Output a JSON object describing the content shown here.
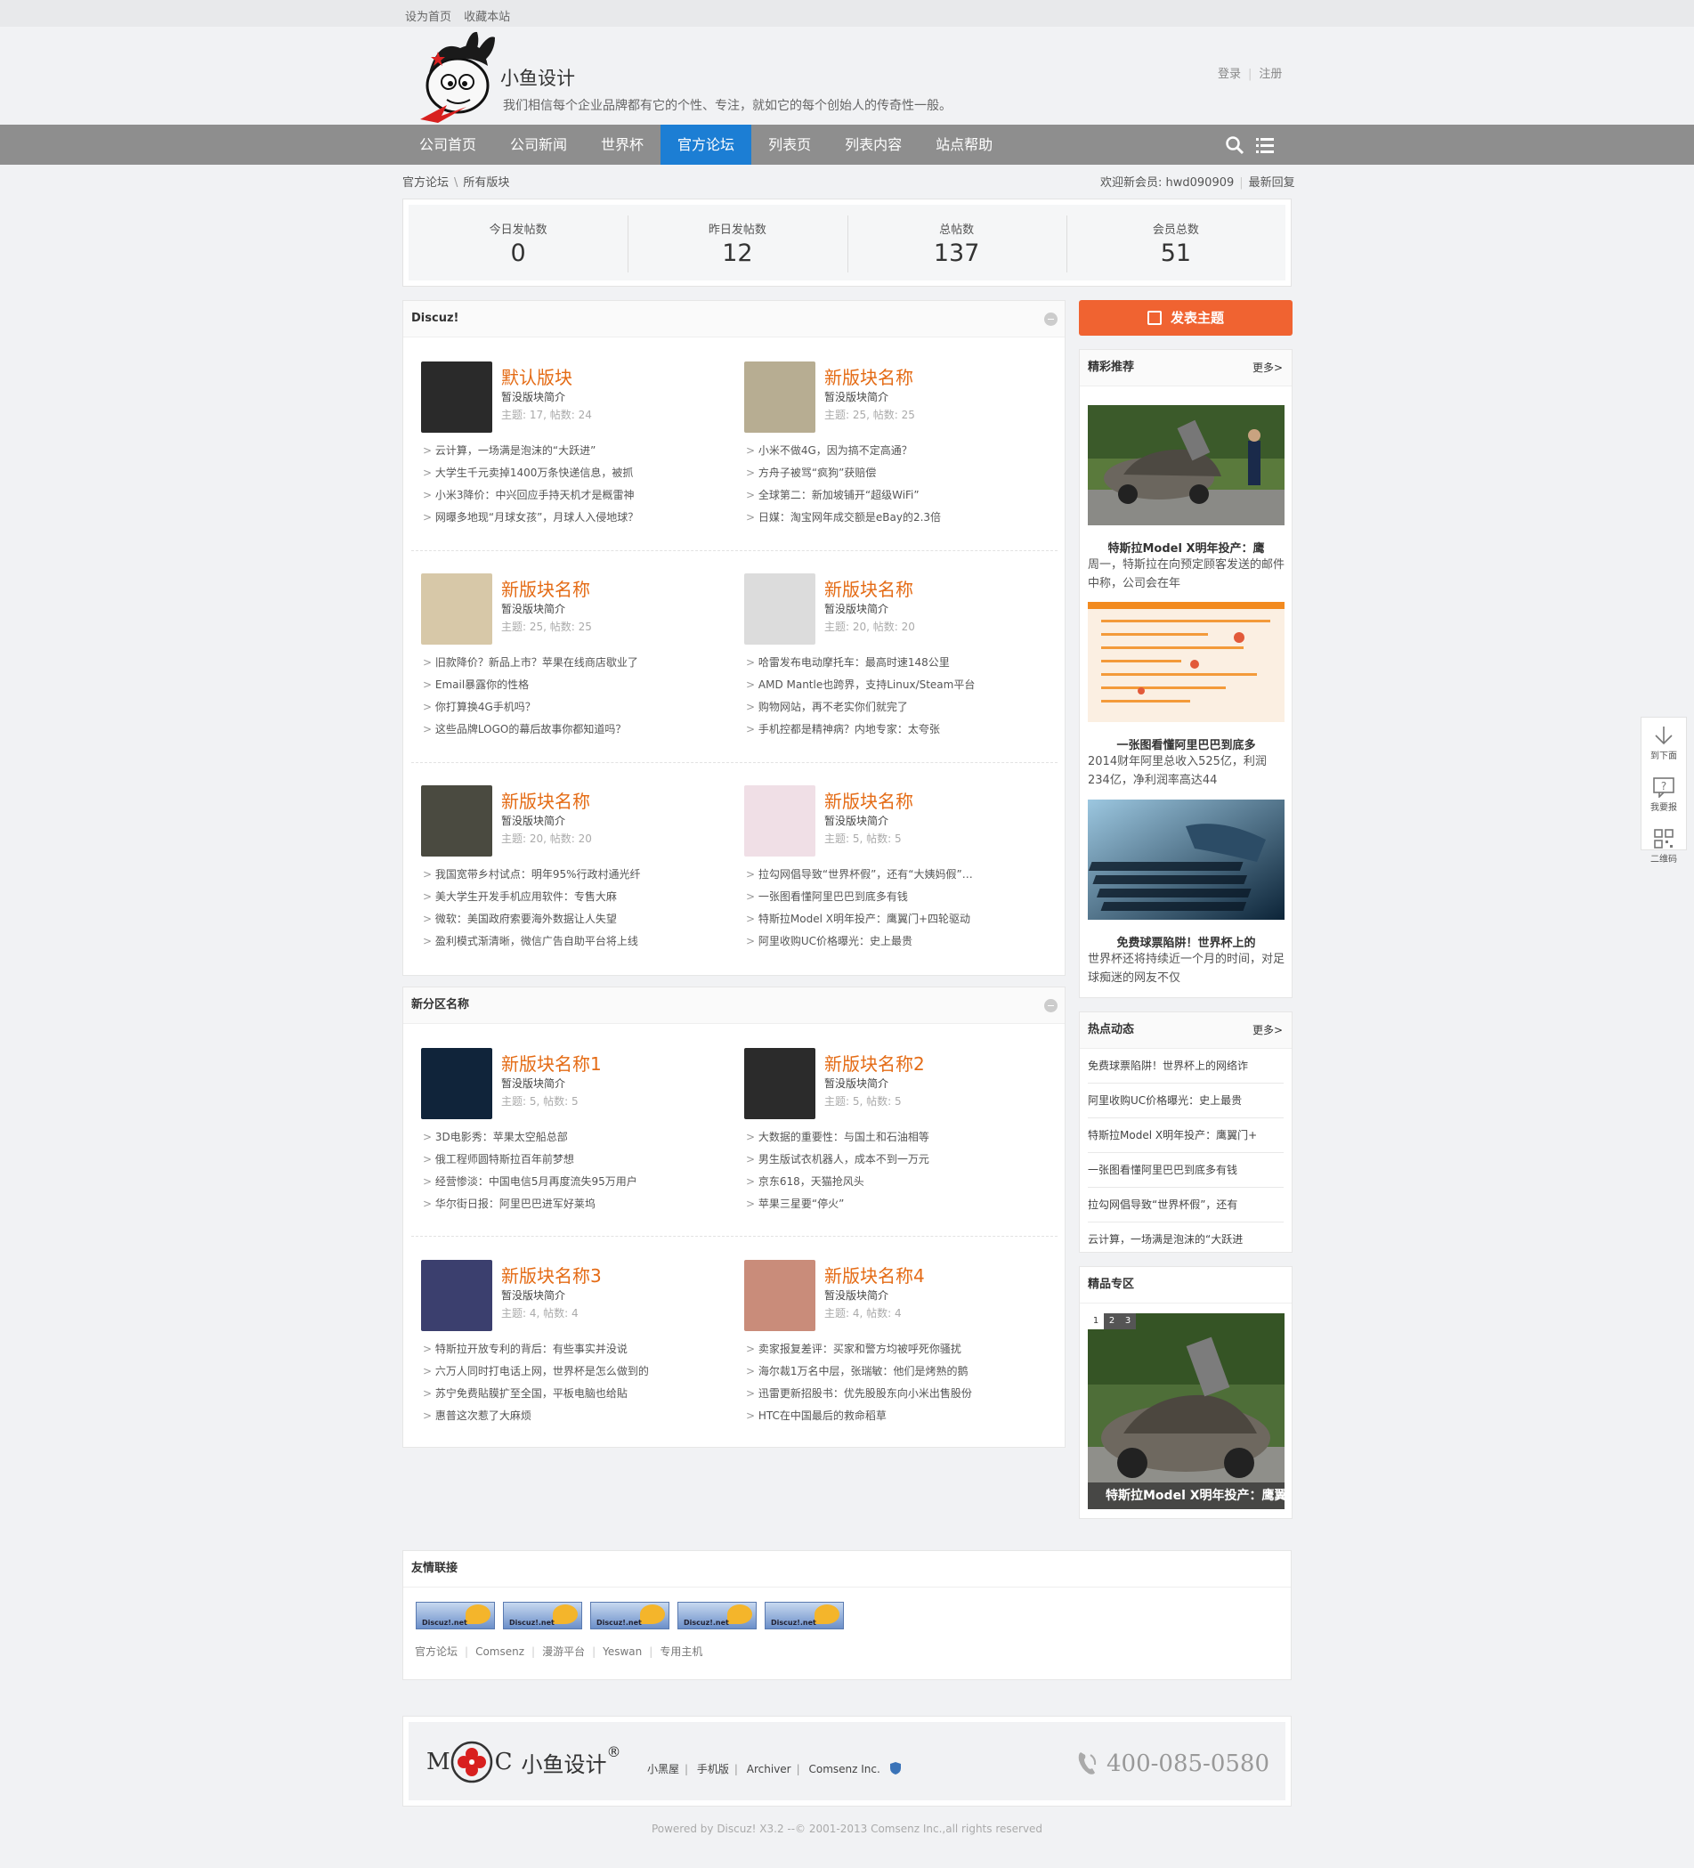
{
  "topbar": {
    "set_home": "设为首页",
    "bookmark": "收藏本站"
  },
  "header": {
    "site_name": "小鱼设计",
    "slogan": "我们相信每个企业品牌都有它的个性、专注，就如它的每个创始人的传奇性一般。",
    "login": "登录",
    "register": "注册"
  },
  "nav": {
    "items": [
      "公司首页",
      "公司新闻",
      "世界杯",
      "官方论坛",
      "列表页",
      "列表内容",
      "站点帮助"
    ],
    "active": "官方论坛"
  },
  "breadcrumb": {
    "root": "官方论坛",
    "current": "所有版块",
    "separator": "\\"
  },
  "welcome": {
    "text": "欢迎新会员: hwd090909",
    "latest_reply": "最新回复"
  },
  "stats": [
    {
      "label": "今日发帖数",
      "value": "0"
    },
    {
      "label": "昨日发帖数",
      "value": "12"
    },
    {
      "label": "总帖数",
      "value": "137"
    },
    {
      "label": "会员总数",
      "value": "51"
    }
  ],
  "section1": {
    "title": "Discuz!",
    "forums": [
      {
        "name": "默认版块",
        "desc": "暂没版块简介",
        "count": "主题: 17, 帖数: 24",
        "thumb_color": "#2a2a2a",
        "threads": [
          "云计算，一场满是泡沫的“大跃进”",
          "大学生千元卖掉1400万条快递信息，被抓",
          "小米3降价：中兴回应手持天机才是概雷神",
          "网曝多地现“月球女孩”，月球人入侵地球？"
        ]
      },
      {
        "name": "新版块名称",
        "desc": "暂没版块简介",
        "count": "主题: 25, 帖数: 25",
        "thumb_color": "#b7ad92",
        "threads": [
          "小米不做4G，因为搞不定高通？",
          "方舟子被骂“疯狗”获赔偿",
          "全球第二：新加坡铺开“超级WiFi”",
          "日媒：淘宝网年成交额是eBay的2.3倍"
        ]
      },
      {
        "name": "新版块名称",
        "desc": "暂没版块简介",
        "count": "主题: 25, 帖数: 25",
        "thumb_color": "#d7c8a8",
        "threads": [
          "旧款降价？新品上市？苹果在线商店歇业了",
          "Email暴露你的性格",
          "你打算换4G手机吗？",
          "这些品牌LOGO的幕后故事你都知道吗？"
        ]
      },
      {
        "name": "新版块名称",
        "desc": "暂没版块简介",
        "count": "主题: 20, 帖数: 20",
        "thumb_color": "#dcdcdc",
        "threads": [
          "哈雷发布电动摩托车：最高时速148公里",
          "AMD Mantle也跨界，支持Linux/Steam平台",
          "购物网站，再不老实你们就完了",
          "手机控都是精神病？内地专家：太夸张"
        ]
      },
      {
        "name": "新版块名称",
        "desc": "暂没版块简介",
        "count": "主题: 20, 帖数: 20",
        "thumb_color": "#4a4a40",
        "threads": [
          "我国宽带乡村试点：明年95%行政村通光纤",
          "美大学生开发手机应用软件：专售大麻",
          "微软：美国政府索要海外数据让人失望",
          "盈利模式渐清晰，微信广告自助平台将上线"
        ]
      },
      {
        "name": "新版块名称",
        "desc": "暂没版块简介",
        "count": "主题: 5, 帖数: 5",
        "thumb_color": "#f0dfe6",
        "threads": [
          "拉勾网倡导致“世界杯假”，还有“大姨妈假”…",
          "一张图看懂阿里巴巴到底多有钱",
          "特斯拉Model X明年投产：鹰翼门+四轮驱动",
          "阿里收购UC价格曝光：史上最贵"
        ]
      }
    ]
  },
  "section2": {
    "title": "新分区名称",
    "forums": [
      {
        "name": "新版块名称1",
        "desc": "暂没版块简介",
        "count": "主题: 5, 帖数: 5",
        "thumb_color": "#10243a",
        "threads": [
          "3D电影秀：苹果太空船总部",
          "俄工程师圆特斯拉百年前梦想",
          "经营惨淡：中国电信5月再度流失95万用户",
          "华尔街日报：阿里巴巴进军好莱坞"
        ]
      },
      {
        "name": "新版块名称2",
        "desc": "暂没版块简介",
        "count": "主题: 5, 帖数: 5",
        "thumb_color": "#2b2b2b",
        "threads": [
          "大数据的重要性：与国土和石油相等",
          "男生版试衣机器人，成本不到一万元",
          "京东618，天猫抢风头",
          "苹果三星要“停火”"
        ]
      },
      {
        "name": "新版块名称3",
        "desc": "暂没版块简介",
        "count": "主题: 4, 帖数: 4",
        "thumb_color": "#3b3f6e",
        "threads": [
          "特斯拉开放专利的背后：有些事实并没说",
          "六万人同时打电话上网，世界杯是怎么做到的",
          "苏宁免费貼膜扩至全国，平板电脑也给貼",
          "惠普这次惹了大麻烦"
        ]
      },
      {
        "name": "新版块名称4",
        "desc": "暂没版块简介",
        "count": "主题: 4, 帖数: 4",
        "thumb_color": "#c98c7a",
        "threads": [
          "卖家报复差评：买家和警方均被呼死你骚扰",
          "海尔裁1万名中层，张瑞敏：他们是烤熟的鹅",
          "迅雷更新招股书：优先股股东向小米出售股份",
          "HTC在中国最后的救命稻草"
        ]
      }
    ]
  },
  "sidebar": {
    "post_button": "发表主题",
    "recommend": {
      "title": "精彩推荐",
      "more": "更多>",
      "items": [
        {
          "title": "特斯拉Model X明年投产：鹰",
          "desc": "周一，特斯拉在向预定顾客发送的邮件中称，公司会在年"
        },
        {
          "title": "一张图看懂阿里巴巴到底多",
          "desc": "2014财年阿里总收入525亿，利润234亿，净利润率高达44"
        },
        {
          "title": "免费球票陷阱！世界杯上的",
          "desc": "世界杯还将持续近一个月的时间，对足球痴迷的网友不仅"
        }
      ]
    },
    "hot": {
      "title": "热点动态",
      "more": "更多>",
      "items": [
        "免费球票陷阱！世界杯上的网络诈",
        "阿里收购UC价格曝光：史上最贵",
        "特斯拉Model X明年投产：鹰翼门+",
        "一张图看懂阿里巴巴到底多有钱",
        "拉勾网倡导致“世界杯假”，还有",
        "云计算，一场满是泡沫的“大跃进"
      ]
    },
    "featured": {
      "title": "精品专区",
      "slides": [
        "1",
        "2",
        "3"
      ],
      "caption": "特斯拉Model X明年投产：鹰翼"
    }
  },
  "links": {
    "title": "友情联接",
    "logo_text": "Discuz!.net",
    "logo_count": 5,
    "text_links": [
      "官方论坛",
      "Comsenz",
      "漫游平台",
      "Yeswan",
      "专用主机"
    ]
  },
  "footer": {
    "brand": "小鱼设计",
    "brand_mark": "MC",
    "registered": "®",
    "links": [
      "小黑屋",
      "手机版",
      "Archiver",
      "Comsenz Inc."
    ],
    "phone": "400-085-0580",
    "copyright": "Powered by Discuz! X3.2 --© 2001-2013 Comsenz Inc.,all rights reserved"
  },
  "float_tools": [
    "到下面",
    "我要报",
    "二维码"
  ]
}
